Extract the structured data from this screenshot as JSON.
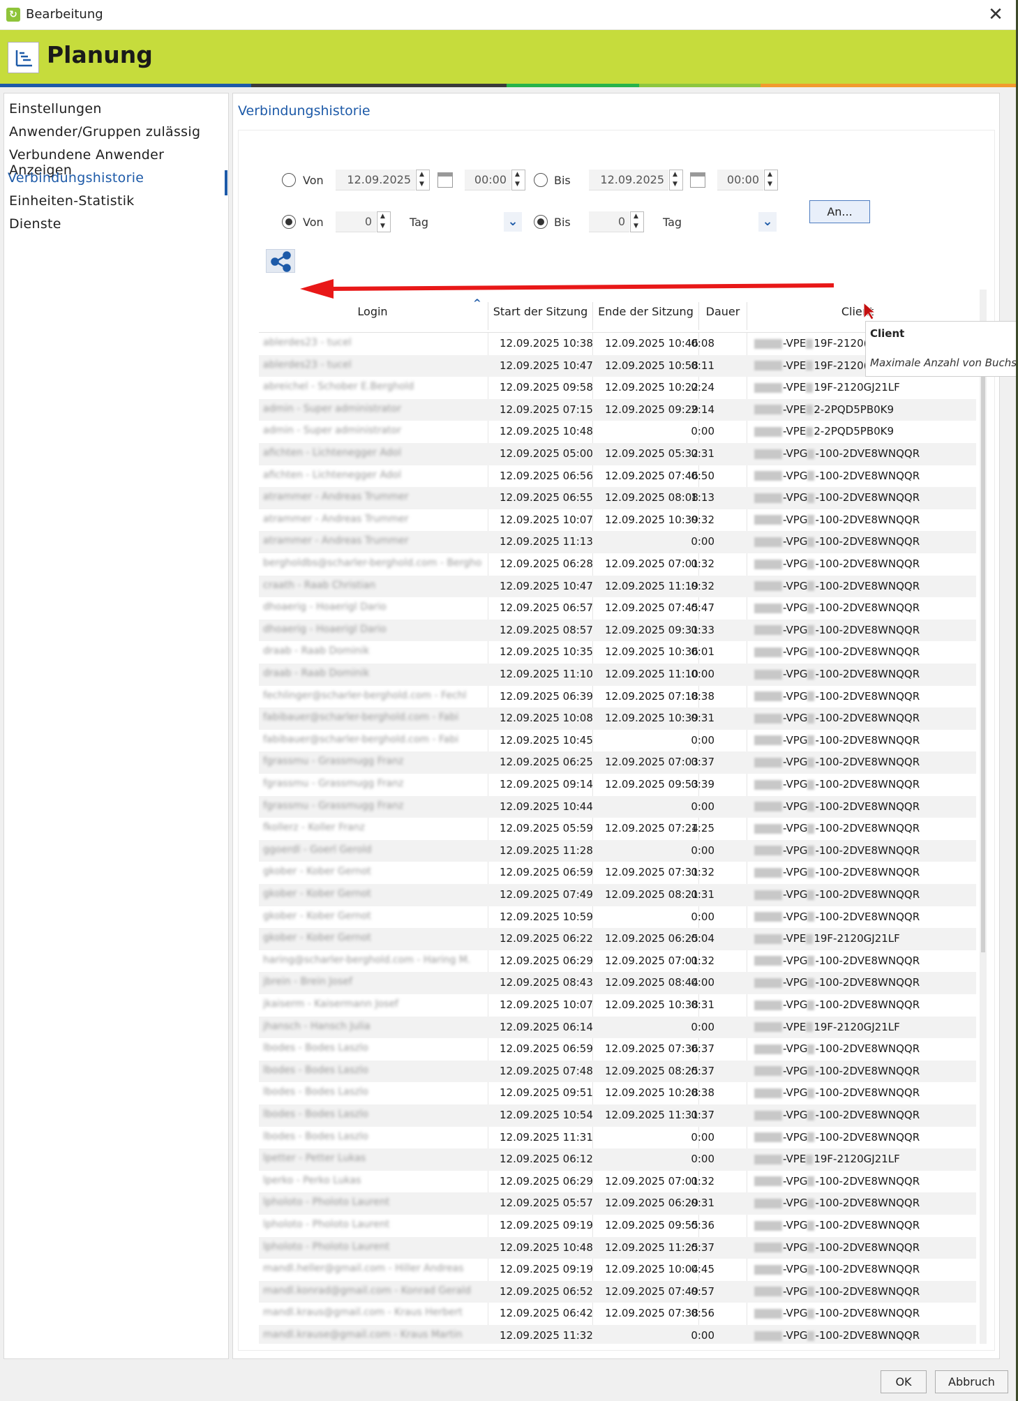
{
  "window": {
    "title": "Bearbeitung",
    "close_label": "✕"
  },
  "header": {
    "title": "Planung"
  },
  "colors": {
    "accent": "#1d5aa8",
    "header_bg": "#c6dc3c",
    "strip": [
      "#1d5aa8",
      "#3a3a3a",
      "#27b34a",
      "#8cc63f",
      "#f29a2e"
    ]
  },
  "sidebar": {
    "items": [
      {
        "label": "Einstellungen",
        "active": false
      },
      {
        "label": "Anwender/Gruppen zulässig",
        "active": false
      },
      {
        "label": "Verbundene Anwender Anzeigen",
        "active": false
      },
      {
        "label": "Verbindungshistorie",
        "active": true
      },
      {
        "label": "Einheiten-Statistik",
        "active": false
      },
      {
        "label": "Dienste",
        "active": false
      }
    ]
  },
  "panel": {
    "title": "Verbindungshistorie",
    "filter": {
      "row1": {
        "from_label": "Von",
        "from_date": "12.09.2025",
        "from_time": "00:00",
        "to_label": "Bis",
        "to_date": "12.09.2025",
        "to_time": "00:00",
        "checked": false
      },
      "row2": {
        "from_label": "Von",
        "from_value": "0",
        "from_unit": "Tag",
        "to_label": "Bis",
        "to_value": "0",
        "to_unit": "Tag",
        "checked": true
      },
      "apply_label": "An..."
    },
    "icons": {
      "share": "share-icon",
      "calendar": "calendar-icon",
      "sort": "sort-ascending-icon",
      "dropdown": "chevron-down-icon"
    }
  },
  "table": {
    "columns": [
      "Login",
      "Start der Sitzung",
      "Ende der Sitzung",
      "Dauer",
      "Client"
    ],
    "rows": [
      [
        "ablerdes23 - tucel",
        "12.09.2025 10:38",
        "12.09.2025 10:46",
        "0:08",
        "-VPE",
        "19F-2120("
      ],
      [
        "ablerdes23 - tucel",
        "12.09.2025 10:47",
        "12.09.2025 10:58",
        "0:11",
        "-VPE",
        "19F-2120("
      ],
      [
        "abreichel - Schober E.Berghold",
        "12.09.2025 09:58",
        "12.09.2025 10:22",
        "0:24",
        "-VPE",
        "19F-2120GJ21LF"
      ],
      [
        "admin - Super administrator",
        "12.09.2025 07:15",
        "12.09.2025 09:29",
        "2:14",
        "-VPE",
        "2-2PQD5PB0K9"
      ],
      [
        "admin - Super administrator",
        "12.09.2025 10:48",
        "",
        "0:00",
        "-VPE",
        "2-2PQD5PB0K9"
      ],
      [
        "afichten - Lichtenegger Adol",
        "12.09.2025 05:00",
        "12.09.2025 05:32",
        "0:31",
        "-VPG",
        "-100-2DVE8WNQQR"
      ],
      [
        "afichten - Lichtenegger Adol",
        "12.09.2025 06:56",
        "12.09.2025 07:46",
        "0:50",
        "-VPG",
        "-100-2DVE8WNQQR"
      ],
      [
        "atrammer - Andreas Trummer",
        "12.09.2025 06:55",
        "12.09.2025 08:08",
        "1:13",
        "-VPG",
        "-100-2DVE8WNQQR"
      ],
      [
        "atrammer - Andreas Trummer",
        "12.09.2025 10:07",
        "12.09.2025 10:39",
        "0:32",
        "-VPG",
        "-100-2DVE8WNQQR"
      ],
      [
        "atrammer - Andreas Trummer",
        "12.09.2025 11:13",
        "",
        "0:00",
        "-VPG",
        "-100-2DVE8WNQQR"
      ],
      [
        "bergholdbs@scharler-berghold.com - Bergho",
        "12.09.2025 06:28",
        "12.09.2025 07:01",
        "0:32",
        "-VPG",
        "-100-2DVE8WNQQR"
      ],
      [
        "craath - Raab Christian",
        "12.09.2025 10:47",
        "12.09.2025 11:19",
        "0:32",
        "-VPG",
        "-100-2DVE8WNQQR"
      ],
      [
        "dhoaerig - Hoaerigl Dario",
        "12.09.2025 06:57",
        "12.09.2025 07:45",
        "0:47",
        "-VPG",
        "-100-2DVE8WNQQR"
      ],
      [
        "dhoaerig - Hoaerigl Dario",
        "12.09.2025 08:57",
        "12.09.2025 09:31",
        "0:33",
        "-VPG",
        "-100-2DVE8WNQQR"
      ],
      [
        "draab - Raab Dominik",
        "12.09.2025 10:35",
        "12.09.2025 10:36",
        "0:01",
        "-VPG",
        "-100-2DVE8WNQQR"
      ],
      [
        "draab - Raab Dominik",
        "12.09.2025 11:10",
        "12.09.2025 11:10",
        "0:00",
        "-VPG",
        "-100-2DVE8WNQQR"
      ],
      [
        "fechlinger@scharler-berghold.com - Fechl",
        "12.09.2025 06:39",
        "12.09.2025 07:18",
        "0:38",
        "-VPG",
        "-100-2DVE8WNQQR"
      ],
      [
        "fabibauer@scharler-berghold.com - Fabi",
        "12.09.2025 10:08",
        "12.09.2025 10:39",
        "0:31",
        "-VPG",
        "-100-2DVE8WNQQR"
      ],
      [
        "fabibauer@scharler-berghold.com - Fabi",
        "12.09.2025 10:45",
        "",
        "0:00",
        "-VPG",
        "-100-2DVE8WNQQR"
      ],
      [
        "fgrassmu - Grassmugg Franz",
        "12.09.2025 06:25",
        "12.09.2025 07:03",
        "0:37",
        "-VPG",
        "-100-2DVE8WNQQR"
      ],
      [
        "fgrassmu - Grassmugg Franz",
        "12.09.2025 09:14",
        "12.09.2025 09:53",
        "0:39",
        "-VPG",
        "-100-2DVE8WNQQR"
      ],
      [
        "fgrassmu - Grassmugg Franz",
        "12.09.2025 10:44",
        "",
        "0:00",
        "-VPG",
        "-100-2DVE8WNQQR"
      ],
      [
        "fkollerz - Koller Franz",
        "12.09.2025 05:59",
        "12.09.2025 07:24",
        "1:25",
        "-VPG",
        "-100-2DVE8WNQQR"
      ],
      [
        "ggoerdl - Goerl Gerold",
        "12.09.2025 11:28",
        "",
        "0:00",
        "-VPG",
        "-100-2DVE8WNQQR"
      ],
      [
        "gkober - Kober Gernot",
        "12.09.2025 06:59",
        "12.09.2025 07:31",
        "0:32",
        "-VPG",
        "-100-2DVE8WNQQR"
      ],
      [
        "gkober - Kober Gernot",
        "12.09.2025 07:49",
        "12.09.2025 08:21",
        "0:31",
        "-VPG",
        "-100-2DVE8WNQQR"
      ],
      [
        "gkober - Kober Gernot",
        "12.09.2025 10:59",
        "",
        "0:00",
        "-VPG",
        "-100-2DVE8WNQQR"
      ],
      [
        "gkober - Kober Gernot",
        "12.09.2025 06:22",
        "12.09.2025 06:25",
        "0:04",
        "-VPE",
        "19F-2120GJ21LF"
      ],
      [
        "haring@scharler-berghold.com - Haring M.",
        "12.09.2025 06:29",
        "12.09.2025 07:01",
        "0:32",
        "-VPG",
        "-100-2DVE8WNQQR"
      ],
      [
        "jbrein - Brein Josef",
        "12.09.2025 08:43",
        "12.09.2025 08:44",
        "0:00",
        "-VPG",
        "-100-2DVE8WNQQR"
      ],
      [
        "jkaiserm - Kaisermann Josef",
        "12.09.2025 10:07",
        "12.09.2025 10:38",
        "0:31",
        "-VPG",
        "-100-2DVE8WNQQR"
      ],
      [
        "jhansch - Hansch Julia",
        "12.09.2025 06:14",
        "",
        "0:00",
        "-VPE",
        "19F-2120GJ21LF"
      ],
      [
        "lbodes - Bodes Laszlo",
        "12.09.2025 06:59",
        "12.09.2025 07:36",
        "0:37",
        "-VPG",
        "-100-2DVE8WNQQR"
      ],
      [
        "lbodes - Bodes Laszlo",
        "12.09.2025 07:48",
        "12.09.2025 08:25",
        "0:37",
        "-VPG",
        "-100-2DVE8WNQQR"
      ],
      [
        "lbodes - Bodes Laszlo",
        "12.09.2025 09:51",
        "12.09.2025 10:28",
        "0:38",
        "-VPG",
        "-100-2DVE8WNQQR"
      ],
      [
        "lbodes - Bodes Laszlo",
        "12.09.2025 10:54",
        "12.09.2025 11:31",
        "0:37",
        "-VPG",
        "-100-2DVE8WNQQR"
      ],
      [
        "lbodes - Bodes Laszlo",
        "12.09.2025 11:31",
        "",
        "0:00",
        "-VPG",
        "-100-2DVE8WNQQR"
      ],
      [
        "lpetter - Petter Lukas",
        "12.09.2025 06:12",
        "",
        "0:00",
        "-VPE",
        "19F-2120GJ21LF"
      ],
      [
        "lperko - Perko Lukas",
        "12.09.2025 06:29",
        "12.09.2025 07:01",
        "0:32",
        "-VPG",
        "-100-2DVE8WNQQR"
      ],
      [
        "lpholoto - Pholoto Laurent",
        "12.09.2025 05:57",
        "12.09.2025 06:29",
        "0:31",
        "-VPG",
        "-100-2DVE8WNQQR"
      ],
      [
        "lpholoto - Pholoto Laurent",
        "12.09.2025 09:19",
        "12.09.2025 09:55",
        "0:36",
        "-VPG",
        "-100-2DVE8WNQQR"
      ],
      [
        "lpholoto - Pholoto Laurent",
        "12.09.2025 10:48",
        "12.09.2025 11:25",
        "0:37",
        "-VPG",
        "-100-2DVE8WNQQR"
      ],
      [
        "mandl.heller@gmail.com - Hiller Andreas",
        "12.09.2025 09:19",
        "12.09.2025 10:04",
        "0:45",
        "-VPG",
        "-100-2DVE8WNQQR"
      ],
      [
        "mandl.konrad@gmail.com - Konrad Gerald",
        "12.09.2025 06:52",
        "12.09.2025 07:49",
        "0:57",
        "-VPG",
        "-100-2DVE8WNQQR"
      ],
      [
        "mandl.kraus@gmail.com - Kraus Herbert",
        "12.09.2025 06:42",
        "12.09.2025 07:38",
        "0:56",
        "-VPG",
        "-100-2DVE8WNQQR"
      ],
      [
        "mandl.krause@gmail.com - Kraus Martin",
        "12.09.2025 11:32",
        "",
        "0:00",
        "-VPG",
        "-100-2DVE8WNQQR"
      ]
    ]
  },
  "tooltip": {
    "title": "Client",
    "text": "Maximale Anzahl von Buchst"
  },
  "footer": {
    "ok_label": "OK",
    "cancel_label": "Abbruch"
  }
}
